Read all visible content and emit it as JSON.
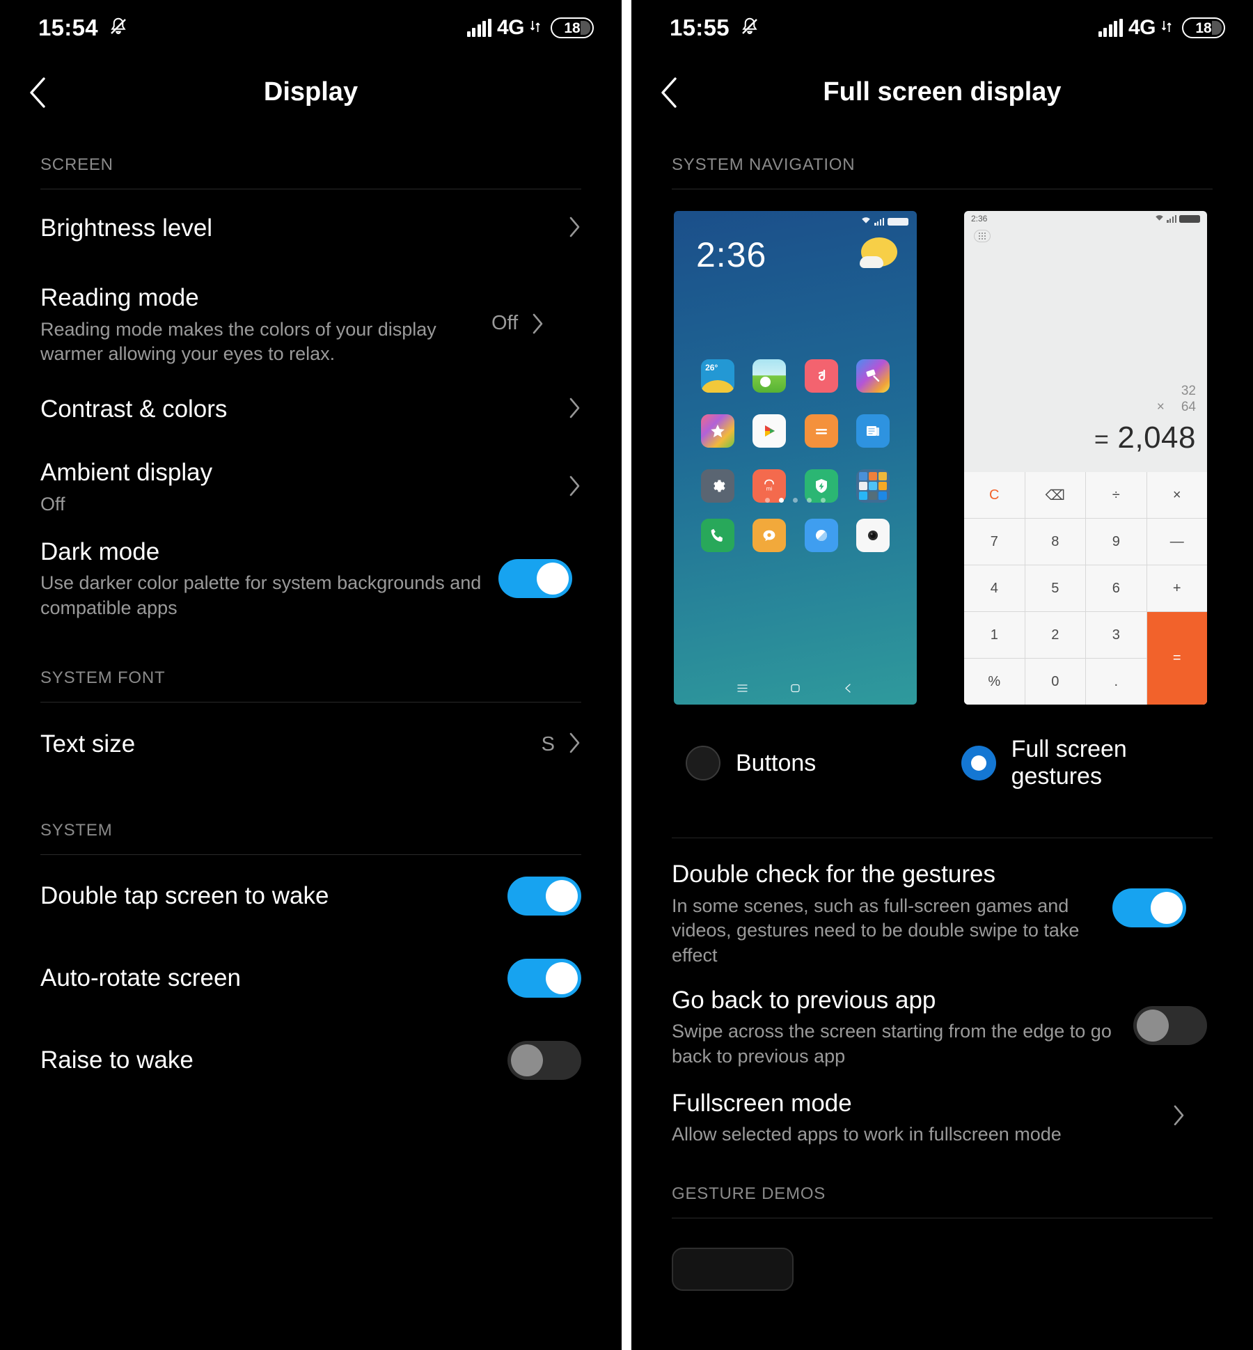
{
  "left_panel": {
    "status_bar": {
      "time": "15:54",
      "mute_icon": "bell-muted-icon",
      "network": "4G",
      "battery_level": "18"
    },
    "app_bar": {
      "title": "Display",
      "back_icon": "chevron-left-icon"
    },
    "sections": [
      {
        "header": "SCREEN",
        "rows": [
          {
            "title": "Brightness level",
            "sub": "",
            "value": "",
            "control": "chevron"
          },
          {
            "title": "Reading mode",
            "sub": "Reading mode makes the colors of your display warmer allowing your eyes to relax.",
            "value": "Off",
            "control": "chevron"
          },
          {
            "title": "Contrast & colors",
            "sub": "",
            "value": "",
            "control": "chevron"
          },
          {
            "title": "Ambient display",
            "sub": "Off",
            "value": "",
            "control": "chevron"
          },
          {
            "title": "Dark mode",
            "sub": "Use darker color palette for system backgrounds and compatible apps",
            "value": "",
            "control": "toggle-on"
          }
        ]
      },
      {
        "header": "SYSTEM FONT",
        "rows": [
          {
            "title": "Text size",
            "sub": "",
            "value": "S",
            "control": "chevron"
          }
        ]
      },
      {
        "header": "SYSTEM",
        "rows": [
          {
            "title": "Double tap screen to wake",
            "sub": "",
            "value": "",
            "control": "toggle-on"
          },
          {
            "title": "Auto-rotate screen",
            "sub": "",
            "value": "",
            "control": "toggle-on"
          },
          {
            "title": "Raise to wake",
            "sub": "",
            "value": "",
            "control": "toggle-off"
          }
        ]
      }
    ]
  },
  "right_panel": {
    "status_bar": {
      "time": "15:55",
      "mute_icon": "bell-muted-icon",
      "network": "4G",
      "battery_level": "18"
    },
    "app_bar": {
      "title": "Full screen display",
      "back_icon": "chevron-left-icon"
    },
    "nav_section_header": "SYSTEM NAVIGATION",
    "previews": {
      "home": {
        "clock": "2:36",
        "weather_icon": "sun-behind-cloud-icon",
        "app_rows": [
          [
            "26°",
            "gallery-icon",
            "music-icon",
            "themes-icon"
          ],
          [
            "favorites-icon",
            "play-store-icon",
            "calculator-icon",
            "notes-icon"
          ],
          [
            "settings-icon",
            "mi-store-icon",
            "security-icon",
            "tools-folder-icon"
          ]
        ],
        "page_dots": 5,
        "active_dot": 2,
        "dock": [
          "phone-icon",
          "messages-icon",
          "browser-icon",
          "camera-icon"
        ],
        "nav_buttons": [
          "menu-icon",
          "home-icon",
          "back-icon"
        ]
      },
      "calculator": {
        "status_time": "2:36",
        "operand_a": "32",
        "operator": "×",
        "operand_b": "64",
        "equals_sign": "=",
        "result": "2,048",
        "keys": [
          "C",
          "⌫",
          "÷",
          "×",
          "7",
          "8",
          "9",
          "—",
          "4",
          "5",
          "6",
          "+",
          "1",
          "2",
          "3",
          "",
          "%",
          "0",
          ".",
          "="
        ]
      }
    },
    "nav_options": [
      {
        "label": "Buttons",
        "selected": false
      },
      {
        "label": "Full screen gestures",
        "selected": true
      }
    ],
    "rows": [
      {
        "title": "Double check for the gestures",
        "sub": "In some scenes, such as full-screen games and videos, gestures need to be double swipe to take effect",
        "control": "toggle-on"
      },
      {
        "title": "Go back to previous app",
        "sub": "Swipe across the screen starting from the edge to go back to previous app",
        "control": "toggle-off"
      },
      {
        "title": "Fullscreen mode",
        "sub": "Allow selected apps to work in fullscreen mode",
        "control": "chevron"
      }
    ],
    "demos_header": "GESTURE DEMOS"
  },
  "colors": {
    "accent": "#17a3f0",
    "radio_accent": "#1477d3",
    "calc_accent": "#f2622b",
    "background": "#000000",
    "muted_text": "#9a9a9a"
  }
}
